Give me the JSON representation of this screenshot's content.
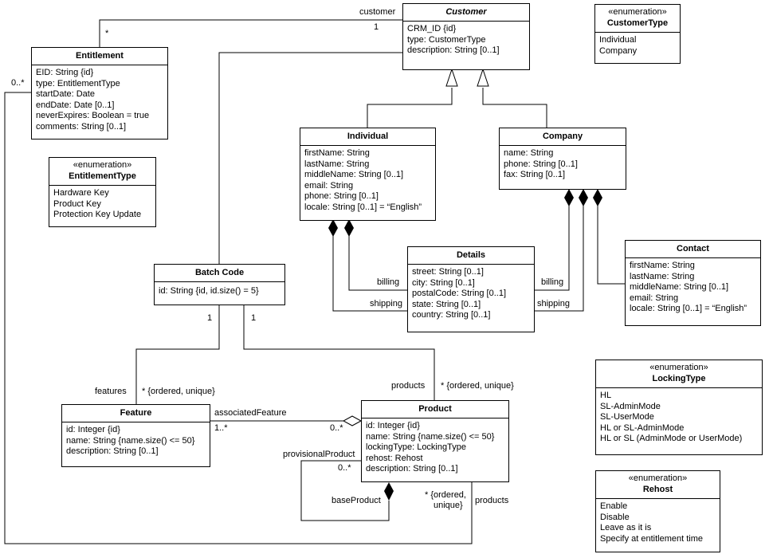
{
  "classes": {
    "customer": {
      "name": "Customer",
      "abstract": true,
      "attributes": [
        "CRM_ID {id}",
        "type: CustomerType",
        "description: String [0..1]"
      ]
    },
    "customer_type": {
      "stereotype": "«enumeration»",
      "name": "CustomerType",
      "literals": [
        "Individual",
        "Company"
      ]
    },
    "entitlement": {
      "name": "Entitlement",
      "attributes": [
        "EID: String {id}",
        "type: EntitlementType",
        "startDate: Date",
        "endDate: Date [0..1]",
        "neverExpires: Boolean = true",
        "comments: String [0..1]"
      ]
    },
    "entitlement_type": {
      "stereotype": "«enumeration»",
      "name": "EntitlementType",
      "literals": [
        "Hardware Key",
        "Product Key",
        "Protection Key Update"
      ]
    },
    "individual": {
      "name": "Individual",
      "attributes": [
        "firstName: String",
        "lastName: String",
        "middleName: String [0..1]",
        "email: String",
        "phone: String [0..1]",
        "locale: String [0..1] = “English”"
      ]
    },
    "company": {
      "name": "Company",
      "attributes": [
        "name: String",
        "phone: String [0..1]",
        "fax: String [0..1]"
      ]
    },
    "batch_code": {
      "name": "Batch Code",
      "attributes": [
        "id: String {id, id.size() = 5}"
      ]
    },
    "details": {
      "name": "Details",
      "attributes": [
        "street: String [0..1]",
        "city: String [0..1]",
        "postalCode: String [0..1]",
        "state: String [0..1]",
        "country: String [0..1]"
      ]
    },
    "contact": {
      "name": "Contact",
      "attributes": [
        "firstName: String",
        "lastName: String",
        "middleName: String [0..1]",
        "email: String",
        "locale: String [0..1] = “English”"
      ]
    },
    "feature": {
      "name": "Feature",
      "attributes": [
        "id: Integer {id}",
        "name: String {name.size() <= 50}",
        "description: String [0..1]"
      ]
    },
    "product": {
      "name": "Product",
      "attributes": [
        "id: Integer {id}",
        "name: String {name.size() <= 50}",
        "lockingType: LockingType",
        "rehost: Rehost",
        "description: String [0..1]"
      ]
    },
    "locking_type": {
      "stereotype": "«enumeration»",
      "name": "LockingType",
      "literals": [
        "HL",
        "SL-AdminMode",
        "SL-UserMode",
        "HL or SL-AdminMode",
        "HL or SL (AdminMode or UserMode)"
      ]
    },
    "rehost": {
      "stereotype": "«enumeration»",
      "name": "Rehost",
      "literals": [
        "Enable",
        "Disable",
        "Leave as it is",
        "Specify at entitlement time"
      ]
    }
  },
  "labels": {
    "customer_role": "customer",
    "customer_mult": "1",
    "entitlement_mult_star": "*",
    "entitlement_products_mult": "0..*",
    "batch_features_mult": "1",
    "batch_products_mult": "1",
    "features_role": "features",
    "features_mult": "* {ordered, unique}",
    "products_role": "products",
    "products_mult": "* {ordered, unique}",
    "associated_feature_role": "associatedFeature",
    "associated_feature_mult": "1..*",
    "associated_product_mult": "0..*",
    "provisional_product_role": "provisionalProduct",
    "provisional_product_mult": "0..*",
    "base_product_role": "baseProduct",
    "entitlement_products_constraint_1": "* {ordered,",
    "entitlement_products_constraint_2": "unique}",
    "entitlement_products_role": "products",
    "ind_billing": "billing",
    "ind_shipping": "shipping",
    "comp_billing": "billing",
    "comp_shipping": "shipping"
  }
}
